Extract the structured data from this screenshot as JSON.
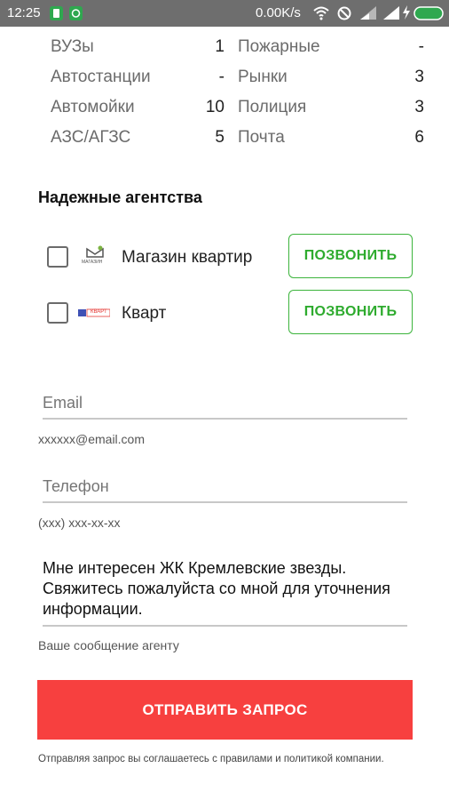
{
  "status_bar": {
    "time": "12:25",
    "network_speed": "0.00K/s",
    "icons": [
      "battery-saver-icon",
      "android-icon",
      "wifi-icon",
      "mute-icon",
      "signal-icon",
      "charging-icon",
      "battery-icon"
    ]
  },
  "stats": {
    "left": [
      {
        "label": "ВУЗы",
        "value": "1"
      },
      {
        "label": "Автостанции",
        "value": "-"
      },
      {
        "label": "Автомойки",
        "value": "10"
      },
      {
        "label": "АЗС/АГЗС",
        "value": "5"
      }
    ],
    "right": [
      {
        "label": "Пожарные",
        "value": "-"
      },
      {
        "label": "Рынки",
        "value": "3"
      },
      {
        "label": "Полиция",
        "value": "3"
      },
      {
        "label": "Почта",
        "value": "6"
      }
    ]
  },
  "agencies": {
    "title": "Надежные агентства",
    "items": [
      {
        "name": "Магазин квартир",
        "logo": "МАГАЗИН",
        "call_label": "ПОЗВОНИТЬ"
      },
      {
        "name": "Кварт",
        "logo": "КВАРТ",
        "call_label": "ПОЗВОНИТЬ"
      }
    ]
  },
  "form": {
    "email": {
      "placeholder": "Email",
      "value": "",
      "helper": "xxxxxx@email.com"
    },
    "phone": {
      "placeholder": "Телефон",
      "value": "",
      "helper": "(xxx) xxx-xx-xx"
    },
    "message": {
      "value": "Мне интересен ЖК Кремлевские звезды. Свяжитесь пожалуйста со мной для уточнения информации.",
      "helper": "Ваше сообщение агенту"
    },
    "submit_label": "ОТПРАВИТЬ ЗАПРОС",
    "terms": "Отправляя запрос вы соглашаетесь с правилами и политикой компании."
  },
  "colors": {
    "status_bar": "#6e6e6e",
    "call_button": "#3cb43c",
    "submit_button": "#f7403f"
  }
}
